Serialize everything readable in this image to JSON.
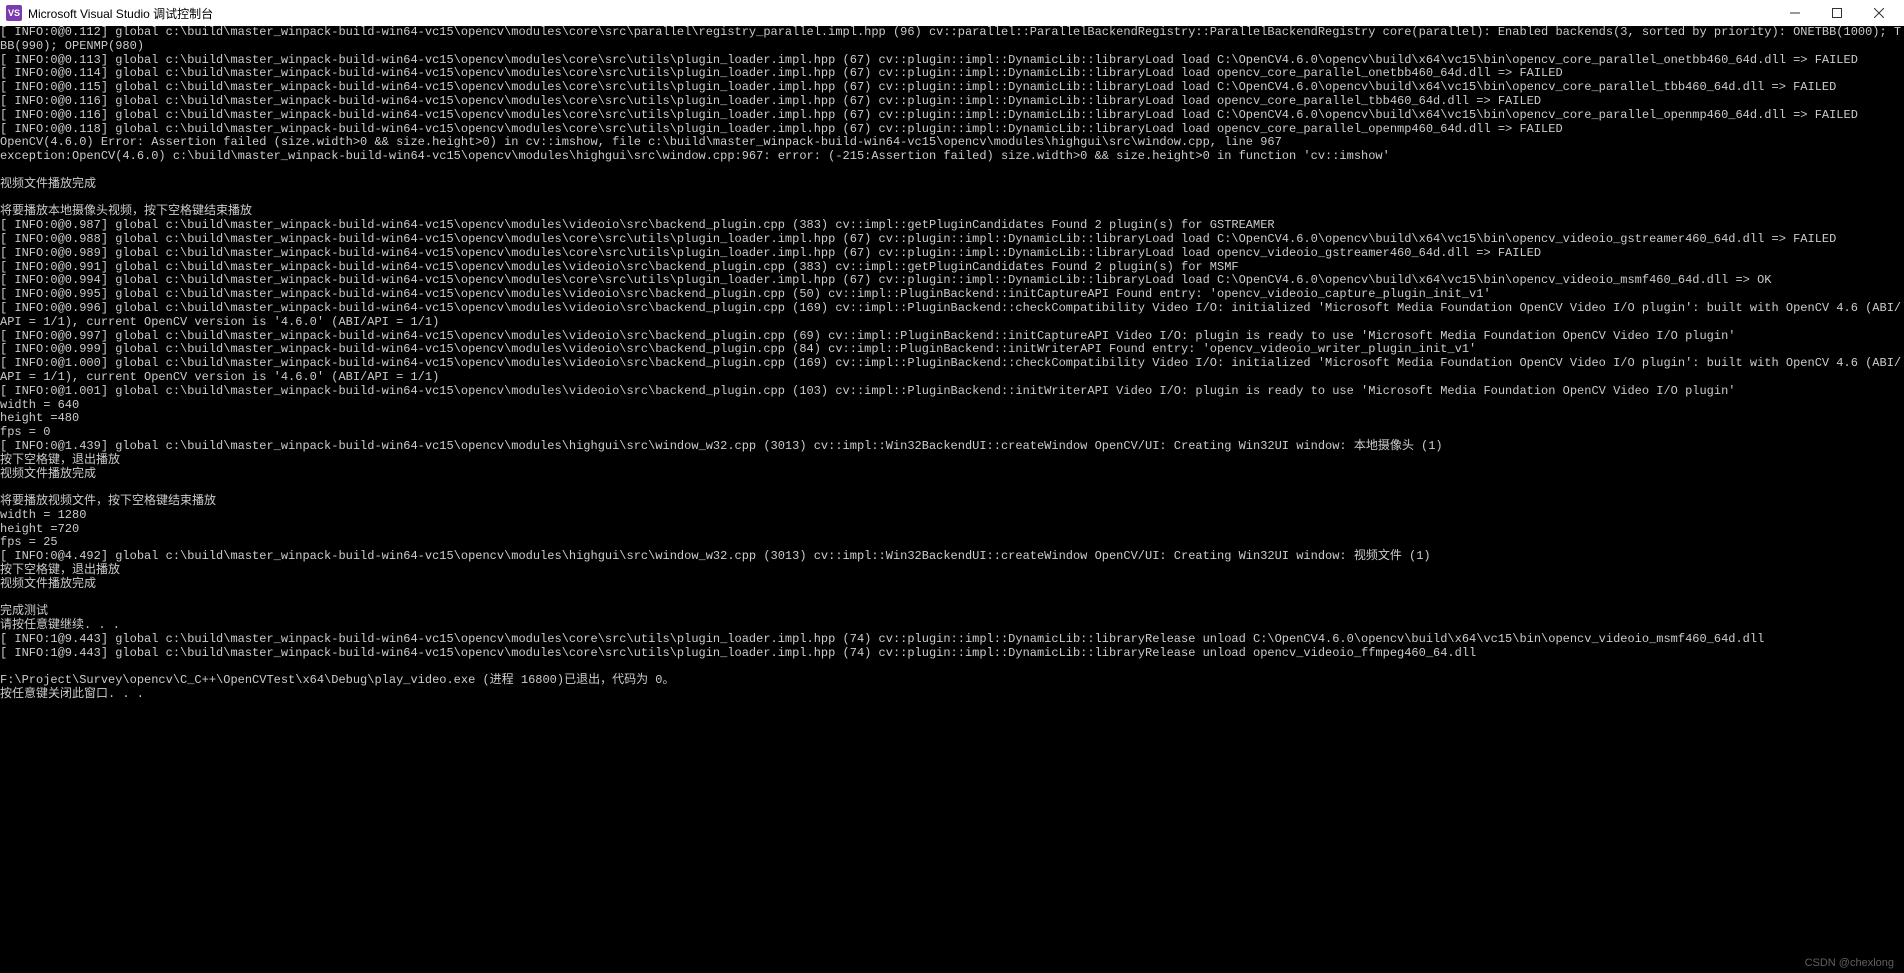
{
  "window": {
    "title": "Microsoft Visual Studio 调试控制台",
    "icon_text": "VS"
  },
  "console_lines": [
    "[ INFO:0@0.112] global c:\\build\\master_winpack-build-win64-vc15\\opencv\\modules\\core\\src\\parallel\\registry_parallel.impl.hpp (96) cv::parallel::ParallelBackendRegistry::ParallelBackendRegistry core(parallel): Enabled backends(3, sorted by priority): ONETBB(1000); TBB(990); OPENMP(980)",
    "[ INFO:0@0.113] global c:\\build\\master_winpack-build-win64-vc15\\opencv\\modules\\core\\src\\utils\\plugin_loader.impl.hpp (67) cv::plugin::impl::DynamicLib::libraryLoad load C:\\OpenCV4.6.0\\opencv\\build\\x64\\vc15\\bin\\opencv_core_parallel_onetbb460_64d.dll => FAILED",
    "[ INFO:0@0.114] global c:\\build\\master_winpack-build-win64-vc15\\opencv\\modules\\core\\src\\utils\\plugin_loader.impl.hpp (67) cv::plugin::impl::DynamicLib::libraryLoad load opencv_core_parallel_onetbb460_64d.dll => FAILED",
    "[ INFO:0@0.115] global c:\\build\\master_winpack-build-win64-vc15\\opencv\\modules\\core\\src\\utils\\plugin_loader.impl.hpp (67) cv::plugin::impl::DynamicLib::libraryLoad load C:\\OpenCV4.6.0\\opencv\\build\\x64\\vc15\\bin\\opencv_core_parallel_tbb460_64d.dll => FAILED",
    "[ INFO:0@0.116] global c:\\build\\master_winpack-build-win64-vc15\\opencv\\modules\\core\\src\\utils\\plugin_loader.impl.hpp (67) cv::plugin::impl::DynamicLib::libraryLoad load opencv_core_parallel_tbb460_64d.dll => FAILED",
    "[ INFO:0@0.116] global c:\\build\\master_winpack-build-win64-vc15\\opencv\\modules\\core\\src\\utils\\plugin_loader.impl.hpp (67) cv::plugin::impl::DynamicLib::libraryLoad load C:\\OpenCV4.6.0\\opencv\\build\\x64\\vc15\\bin\\opencv_core_parallel_openmp460_64d.dll => FAILED",
    "[ INFO:0@0.118] global c:\\build\\master_winpack-build-win64-vc15\\opencv\\modules\\core\\src\\utils\\plugin_loader.impl.hpp (67) cv::plugin::impl::DynamicLib::libraryLoad load opencv_core_parallel_openmp460_64d.dll => FAILED",
    "OpenCV(4.6.0) Error: Assertion failed (size.width>0 && size.height>0) in cv::imshow, file c:\\build\\master_winpack-build-win64-vc15\\opencv\\modules\\highgui\\src\\window.cpp, line 967",
    "exception:OpenCV(4.6.0) c:\\build\\master_winpack-build-win64-vc15\\opencv\\modules\\highgui\\src\\window.cpp:967: error: (-215:Assertion failed) size.width>0 && size.height>0 in function 'cv::imshow'",
    "",
    "视频文件播放完成",
    "",
    "将要播放本地摄像头视频，按下空格键结束播放",
    "[ INFO:0@0.987] global c:\\build\\master_winpack-build-win64-vc15\\opencv\\modules\\videoio\\src\\backend_plugin.cpp (383) cv::impl::getPluginCandidates Found 2 plugin(s) for GSTREAMER",
    "[ INFO:0@0.988] global c:\\build\\master_winpack-build-win64-vc15\\opencv\\modules\\core\\src\\utils\\plugin_loader.impl.hpp (67) cv::plugin::impl::DynamicLib::libraryLoad load C:\\OpenCV4.6.0\\opencv\\build\\x64\\vc15\\bin\\opencv_videoio_gstreamer460_64d.dll => FAILED",
    "[ INFO:0@0.989] global c:\\build\\master_winpack-build-win64-vc15\\opencv\\modules\\core\\src\\utils\\plugin_loader.impl.hpp (67) cv::plugin::impl::DynamicLib::libraryLoad load opencv_videoio_gstreamer460_64d.dll => FAILED",
    "[ INFO:0@0.991] global c:\\build\\master_winpack-build-win64-vc15\\opencv\\modules\\videoio\\src\\backend_plugin.cpp (383) cv::impl::getPluginCandidates Found 2 plugin(s) for MSMF",
    "[ INFO:0@0.994] global c:\\build\\master_winpack-build-win64-vc15\\opencv\\modules\\core\\src\\utils\\plugin_loader.impl.hpp (67) cv::plugin::impl::DynamicLib::libraryLoad load C:\\OpenCV4.6.0\\opencv\\build\\x64\\vc15\\bin\\opencv_videoio_msmf460_64d.dll => OK",
    "[ INFO:0@0.995] global c:\\build\\master_winpack-build-win64-vc15\\opencv\\modules\\videoio\\src\\backend_plugin.cpp (50) cv::impl::PluginBackend::initCaptureAPI Found entry: 'opencv_videoio_capture_plugin_init_v1'",
    "[ INFO:0@0.996] global c:\\build\\master_winpack-build-win64-vc15\\opencv\\modules\\videoio\\src\\backend_plugin.cpp (169) cv::impl::PluginBackend::checkCompatibility Video I/O: initialized 'Microsoft Media Foundation OpenCV Video I/O plugin': built with OpenCV 4.6 (ABI/API = 1/1), current OpenCV version is '4.6.0' (ABI/API = 1/1)",
    "[ INFO:0@0.997] global c:\\build\\master_winpack-build-win64-vc15\\opencv\\modules\\videoio\\src\\backend_plugin.cpp (69) cv::impl::PluginBackend::initCaptureAPI Video I/O: plugin is ready to use 'Microsoft Media Foundation OpenCV Video I/O plugin'",
    "[ INFO:0@0.999] global c:\\build\\master_winpack-build-win64-vc15\\opencv\\modules\\videoio\\src\\backend_plugin.cpp (84) cv::impl::PluginBackend::initWriterAPI Found entry: 'opencv_videoio_writer_plugin_init_v1'",
    "[ INFO:0@1.000] global c:\\build\\master_winpack-build-win64-vc15\\opencv\\modules\\videoio\\src\\backend_plugin.cpp (169) cv::impl::PluginBackend::checkCompatibility Video I/O: initialized 'Microsoft Media Foundation OpenCV Video I/O plugin': built with OpenCV 4.6 (ABI/API = 1/1), current OpenCV version is '4.6.0' (ABI/API = 1/1)",
    "[ INFO:0@1.001] global c:\\build\\master_winpack-build-win64-vc15\\opencv\\modules\\videoio\\src\\backend_plugin.cpp (103) cv::impl::PluginBackend::initWriterAPI Video I/O: plugin is ready to use 'Microsoft Media Foundation OpenCV Video I/O plugin'",
    "width = 640",
    "height =480",
    "fps = 0",
    "[ INFO:0@1.439] global c:\\build\\master_winpack-build-win64-vc15\\opencv\\modules\\highgui\\src\\window_w32.cpp (3013) cv::impl::Win32BackendUI::createWindow OpenCV/UI: Creating Win32UI window: 本地摄像头 (1)",
    "按下空格键，退出播放",
    "视频文件播放完成",
    "",
    "将要播放视频文件，按下空格键结束播放",
    "width = 1280",
    "height =720",
    "fps = 25",
    "[ INFO:0@4.492] global c:\\build\\master_winpack-build-win64-vc15\\opencv\\modules\\highgui\\src\\window_w32.cpp (3013) cv::impl::Win32BackendUI::createWindow OpenCV/UI: Creating Win32UI window: 视频文件 (1)",
    "按下空格键，退出播放",
    "视频文件播放完成",
    "",
    "完成测试",
    "请按任意键继续. . .",
    "[ INFO:1@9.443] global c:\\build\\master_winpack-build-win64-vc15\\opencv\\modules\\core\\src\\utils\\plugin_loader.impl.hpp (74) cv::plugin::impl::DynamicLib::libraryRelease unload C:\\OpenCV4.6.0\\opencv\\build\\x64\\vc15\\bin\\opencv_videoio_msmf460_64d.dll",
    "[ INFO:1@9.443] global c:\\build\\master_winpack-build-win64-vc15\\opencv\\modules\\core\\src\\utils\\plugin_loader.impl.hpp (74) cv::plugin::impl::DynamicLib::libraryRelease unload opencv_videoio_ffmpeg460_64.dll",
    "",
    "F:\\Project\\Survey\\opencv\\C_C++\\OpenCVTest\\x64\\Debug\\play_video.exe (进程 16800)已退出，代码为 0。",
    "按任意键关闭此窗口. . ."
  ],
  "watermark": "CSDN @chexlong"
}
